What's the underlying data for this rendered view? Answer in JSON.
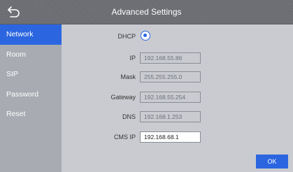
{
  "header": {
    "title": "Advanced Settings",
    "back_icon": "back-arrow-icon"
  },
  "sidebar": {
    "items": [
      {
        "label": "Network",
        "active": true
      },
      {
        "label": "Room",
        "active": false
      },
      {
        "label": "SIP",
        "active": false
      },
      {
        "label": "Password",
        "active": false
      },
      {
        "label": "Reset",
        "active": false
      }
    ]
  },
  "form": {
    "dhcp": {
      "label": "DHCP",
      "selected": true
    },
    "ip": {
      "label": "IP",
      "value": "192.168.55.86"
    },
    "mask": {
      "label": "Mask",
      "value": "255.255.255.0"
    },
    "gateway": {
      "label": "Gateway",
      "value": "192.168.55.254"
    },
    "dns": {
      "label": "DNS",
      "value": "192.168.1.253"
    },
    "cms_ip": {
      "label": "CMS IP",
      "value": "192.168.68.1"
    }
  },
  "buttons": {
    "ok_label": "OK"
  },
  "colors": {
    "accent": "#2b66e0",
    "header": "#707176",
    "sidebar": "#a8abb2",
    "background": "#c9cbd0"
  }
}
